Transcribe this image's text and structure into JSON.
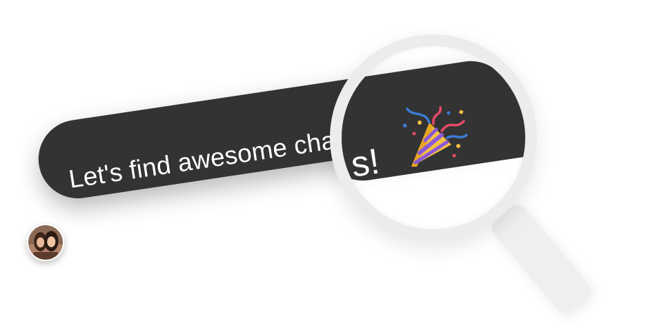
{
  "bubble": {
    "text": "Let's find awesome chars!",
    "text_visible_main": "Let's find awesome char",
    "lens_text": "s!"
  },
  "icons": {
    "party": "party-popper-icon",
    "avatar": "user-avatar",
    "magnifier": "magnifying-glass-icon"
  },
  "colors": {
    "bubble_bg": "#333333",
    "bubble_text": "#ffffff",
    "magnifier": "#ececec",
    "background": "#ffffff"
  }
}
